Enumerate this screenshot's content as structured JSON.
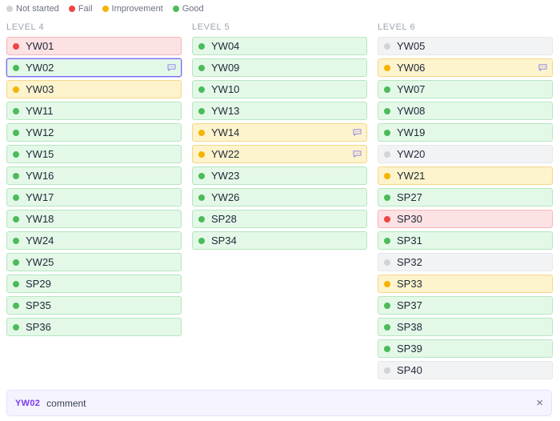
{
  "legend": [
    {
      "label": "Not started",
      "status": "not_started"
    },
    {
      "label": "Fail",
      "status": "fail"
    },
    {
      "label": "Improvement",
      "status": "improvement"
    },
    {
      "label": "Good",
      "status": "good"
    }
  ],
  "colors": {
    "not_started": "#d1d5db",
    "fail": "#ef4444",
    "improvement": "#f5b400",
    "good": "#4cbb5a",
    "selected_border": "#7a6cf0"
  },
  "columns": [
    {
      "title": "LEVEL 4",
      "items": [
        {
          "label": "YW01",
          "status": "fail"
        },
        {
          "label": "YW02",
          "status": "good",
          "comment": true,
          "selected": true
        },
        {
          "label": "YW03",
          "status": "improvement"
        },
        {
          "label": "YW11",
          "status": "good"
        },
        {
          "label": "YW12",
          "status": "good"
        },
        {
          "label": "YW15",
          "status": "good"
        },
        {
          "label": "YW16",
          "status": "good"
        },
        {
          "label": "YW17",
          "status": "good"
        },
        {
          "label": "YW18",
          "status": "good"
        },
        {
          "label": "YW24",
          "status": "good"
        },
        {
          "label": "YW25",
          "status": "good"
        },
        {
          "label": "SP29",
          "status": "good"
        },
        {
          "label": "SP35",
          "status": "good"
        },
        {
          "label": "SP36",
          "status": "good"
        }
      ]
    },
    {
      "title": "LEVEL 5",
      "items": [
        {
          "label": "YW04",
          "status": "good"
        },
        {
          "label": "YW09",
          "status": "good"
        },
        {
          "label": "YW10",
          "status": "good"
        },
        {
          "label": "YW13",
          "status": "good"
        },
        {
          "label": "YW14",
          "status": "improvement",
          "comment": true
        },
        {
          "label": "YW22",
          "status": "improvement",
          "comment": true
        },
        {
          "label": "YW23",
          "status": "good"
        },
        {
          "label": "YW26",
          "status": "good"
        },
        {
          "label": "SP28",
          "status": "good"
        },
        {
          "label": "SP34",
          "status": "good"
        }
      ]
    },
    {
      "title": "LEVEL 6",
      "items": [
        {
          "label": "YW05",
          "status": "not_started"
        },
        {
          "label": "YW06",
          "status": "improvement",
          "comment": true
        },
        {
          "label": "YW07",
          "status": "good"
        },
        {
          "label": "YW08",
          "status": "good"
        },
        {
          "label": "YW19",
          "status": "good"
        },
        {
          "label": "YW20",
          "status": "not_started"
        },
        {
          "label": "YW21",
          "status": "improvement"
        },
        {
          "label": "SP27",
          "status": "good"
        },
        {
          "label": "SP30",
          "status": "fail"
        },
        {
          "label": "SP31",
          "status": "good"
        },
        {
          "label": "SP32",
          "status": "not_started"
        },
        {
          "label": "SP33",
          "status": "improvement"
        },
        {
          "label": "SP37",
          "status": "good"
        },
        {
          "label": "SP38",
          "status": "good"
        },
        {
          "label": "SP39",
          "status": "good"
        },
        {
          "label": "SP40",
          "status": "not_started"
        }
      ]
    }
  ],
  "comment_bar": {
    "code": "YW02",
    "text": "comment",
    "close_icon": "close-icon"
  }
}
